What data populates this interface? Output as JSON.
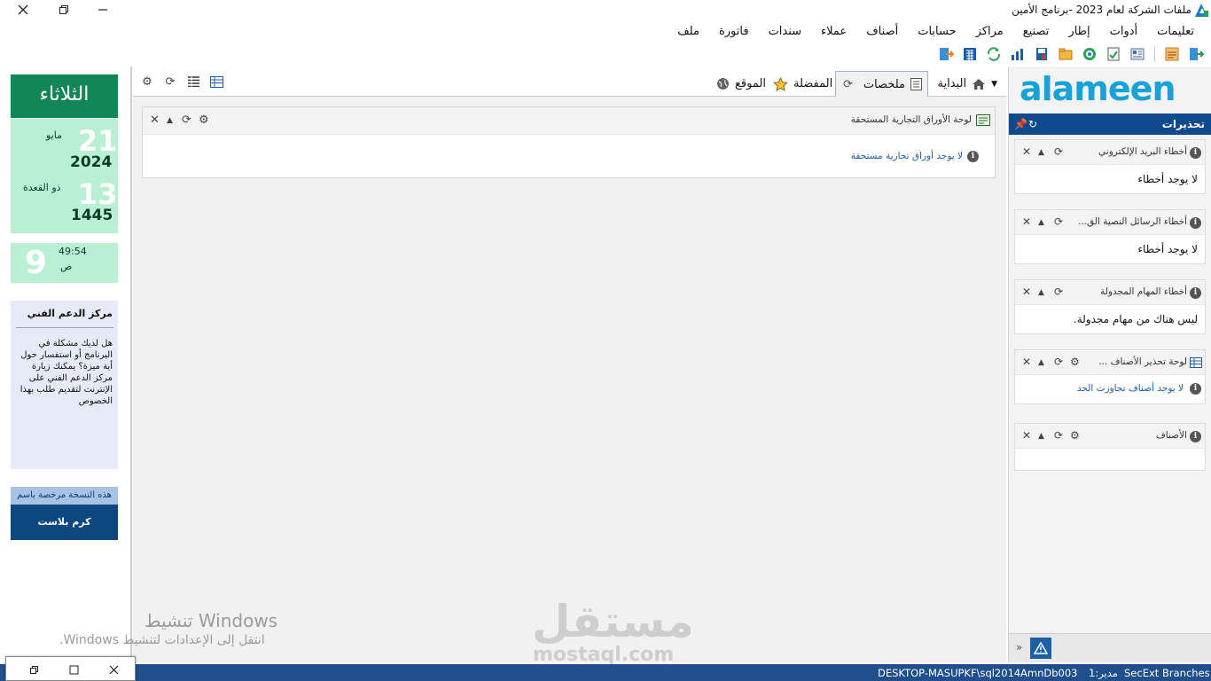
{
  "window": {
    "title": "ملفات الشركة لعام 2023 -برنامج الأمين"
  },
  "menu": [
    "ملف",
    "فاتورة",
    "سندات",
    "عملاء",
    "أصناف",
    "حسابات",
    "مراكز",
    "تصنيع",
    "إطار",
    "أدوات",
    "تعليمات"
  ],
  "toolbar": {
    "icons": [
      "exit-icon",
      "report-icon",
      "card-icon",
      "documents-check-icon",
      "ledger-check-icon",
      "refresh-globe-icon",
      "folder-icon",
      "save-icon",
      "chart-icon",
      "sync-icon",
      "calculator-icon",
      "logout-icon"
    ]
  },
  "alerts_panel": {
    "brand": "alameen",
    "title": "تحذيرات",
    "widgets": [
      {
        "title": "أخطاء البريد الإلكتروني",
        "message": "لا يوجد أخطاء"
      },
      {
        "title": "أخطاء الرسائل النصية الق...",
        "message": "لا يوجد أخطاء"
      },
      {
        "title": "أخطاء المهام المجدولة",
        "message": "ليس هناك من مهام مجدولة."
      },
      {
        "title": "لوحة تحذير الأصناف ...",
        "message": "لا يوجد أصناف تجاوزت الحد"
      },
      {
        "title": "الأصناف",
        "message": ""
      }
    ]
  },
  "calendar": {
    "day_name": "الثلاثاء",
    "greg_day": "21",
    "greg_month": "مايو",
    "greg_year": "2024",
    "hijri_day": "13",
    "hijri_month": "ذو القعدة",
    "hijri_year": "1445",
    "hour": "9",
    "minutes": "49:54",
    "ampm": "ص"
  },
  "support": {
    "title": "مركز الدعم الفني",
    "body": "هل لديك مشكلة في البرنامج أو استفسار حول أية ميزة؟ يمكنك زيارة مركز الدعم الفني على الإنترنت لتقديم طلب بهذا الخصوص"
  },
  "license": {
    "label": "هذه النسخة مرخصة باسم",
    "name": "كرم بلاست"
  },
  "tabs": [
    {
      "label": "البداية",
      "icon": "home-icon"
    },
    {
      "label": "ملخصات",
      "icon": "summary-icon"
    },
    {
      "label": "المفضلة",
      "icon": "star-icon"
    },
    {
      "label": "الموقع",
      "icon": "globe-icon"
    }
  ],
  "center_widget": {
    "title": "لوحة الأوراق التجارية المستحقة",
    "message": "لا يوجد أوراق تجارية مستحقة"
  },
  "watermark": {
    "activate_title": "تنشيط Windows",
    "activate_sub": "انتقل إلى الإعدادات لتنشيط Windows.",
    "brand_ar": "مستقل",
    "brand_en": "mostaql.com"
  },
  "statusbar": {
    "branches": "Branches:",
    "secext": "SecExt",
    "user": "مدير:1",
    "db": "AmnDb003",
    "server": "DESKTOP-MASUPKF\\sql2014"
  },
  "colors": {
    "accent_blue": "#0e4a8c",
    "green": "#138656",
    "light_green": "#b9f0d4",
    "status_blue": "#1f4f8c"
  }
}
